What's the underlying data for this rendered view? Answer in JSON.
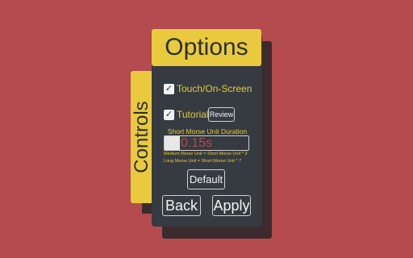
{
  "title": "Options",
  "side_tab": {
    "label": "Controls"
  },
  "options": [
    {
      "label": "Touch/On-Screen",
      "checked": true
    },
    {
      "label": "Tutorial",
      "checked": true
    }
  ],
  "review_label": "Review",
  "duration": {
    "label": "Short Morse Unit Duration",
    "value": "0.15s",
    "fill_fraction": 0.18
  },
  "notes": [
    "Medium Morse Unit = Short Morse Unit * 3",
    "Long Morse Unit = Short Morse Unit * 7"
  ],
  "buttons": {
    "default": "Default",
    "back": "Back",
    "apply": "Apply"
  },
  "colors": {
    "background": "#b34b4f",
    "accent": "#e9c93d",
    "panel": "#353b40"
  },
  "icons": {
    "checkbox": "checkmark-icon"
  }
}
